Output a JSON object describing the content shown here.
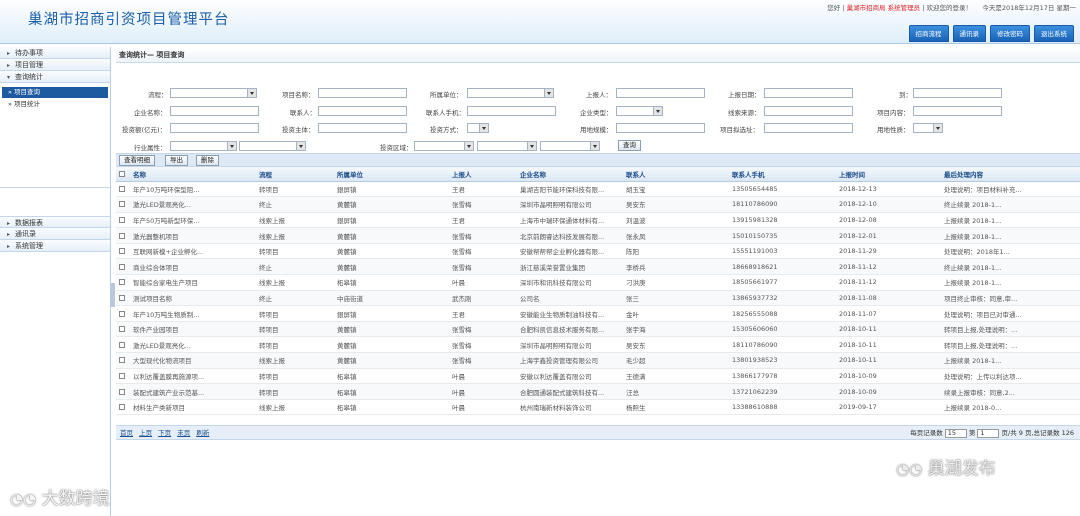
{
  "header": {
    "title": "巢湖市招商引资项目管理平台",
    "greeting_prefix": "您好 |",
    "org": "巢湖市招商局",
    "role": "系统管理员",
    "greeting_suffix": "| 欢迎您的登录！",
    "date": "今天是2018年12月17日 星期一",
    "buttons": [
      "招商流程",
      "通讯录",
      "修改密码",
      "退出系统"
    ]
  },
  "sidebar": {
    "items_top": [
      "待办事项",
      "项目管理",
      "查询统计"
    ],
    "sub_items": [
      "项目查询",
      "项目统计"
    ],
    "items_bottom": [
      "数据报表",
      "通讯录",
      "系统管理"
    ]
  },
  "breadcrumb": "查询统计— 项目查询",
  "form": {
    "labels": {
      "flow": "流程：",
      "project_name": "项目名称：",
      "unit": "所属单位：",
      "reporter": "上报人：",
      "report_date": "上报日期：",
      "to": "到：",
      "company": "企业名称：",
      "contact": "联系人：",
      "contact_phone": "联系人手机：",
      "company_type": "企业类型：",
      "lead_source": "线索来源：",
      "content": "项目内容：",
      "investment": "投资额(亿元)：",
      "invest_body": "投资主体：",
      "invest_method": "投资方式：",
      "land": "用地规模：",
      "site": "项目拟选址：",
      "land_nature": "用地性质：",
      "industry": "行业属性：",
      "region": "投资区域："
    },
    "query_button": "查询"
  },
  "toolbar": [
    "查看明细",
    "导出",
    "删除"
  ],
  "table": {
    "columns": [
      "名称",
      "流程",
      "所属单位",
      "上报人",
      "企业名称",
      "联系人",
      "联系人手机",
      "上报时间",
      "最后处理内容"
    ],
    "rows": [
      [
        "年产10万吨环保型阻...",
        "转项目",
        "銀屏镇",
        "王君",
        "巢湖吉阳节能环保科技有限...",
        "胡玉宝",
        "13505654485",
        "2018-12-13",
        "处理说明：项目材料补充..."
      ],
      [
        "激光LED景观亮化...",
        "终止",
        "黄麓镇",
        "张雪梅",
        "深圳市晶明照明有限公司",
        "吴安东",
        "18110786090",
        "2018-12-10",
        "终止续录 2018-1..."
      ],
      [
        "年产50万吨新型环保...",
        "线索上报",
        "銀屏镇",
        "王君",
        "上海市中瑞环保通体材料有...",
        "刘温波",
        "13915981328",
        "2018-12-08",
        "上报续录 2018-1..."
      ],
      [
        "激光器整机项目",
        "线索上报",
        "黄麓镇",
        "张雪梅",
        "北京前朗睿达科技发展有限...",
        "张永凤",
        "15010150735",
        "2018-12-01",
        "上报续录 2018-1..."
      ],
      [
        "互联网新模+企业孵化...",
        "转项目",
        "黄麓镇",
        "张雪梅",
        "安徽帮帮帮企业孵化器有限...",
        "陈阳",
        "15551191003",
        "2018-11-29",
        "处理说明：2018年1..."
      ],
      [
        "商业综合体项目",
        "终止",
        "黄麓镇",
        "张雪梅",
        "浙江慈溪荣誉置业集团",
        "李桥兵",
        "18668918621",
        "2018-11-12",
        "终止续录 2018-1..."
      ],
      [
        "智能综合家电生产项目",
        "线索上报",
        "柘皋镇",
        "叶晨",
        "深圳市和讯科技有限公司",
        "刁洪庚",
        "18505661977",
        "2018-11-12",
        "上报续录 2018-1..."
      ],
      [
        "测试项目名称",
        "终止",
        "中庙街道",
        "武杰刚",
        "公司名",
        "张三",
        "13865937732",
        "2018-11-08",
        "项目终止审核：同意,审..."
      ],
      [
        "年产10万吨生物质制...",
        "转项目",
        "銀屏镇",
        "王君",
        "安徽能业生物质制油科技有...",
        "金叶",
        "18256555088",
        "2018-11-07",
        "处理说明：项目已对审通..."
      ],
      [
        "软件产业园项目",
        "转项目",
        "黄麓镇",
        "张雪梅",
        "合肥科凯信息技术服务有限...",
        "张宇海",
        "15305606060",
        "2018-10-11",
        "转项目上报,处理说明：..."
      ],
      [
        "激光LED景观亮化...",
        "转项目",
        "黄麓镇",
        "张雪梅",
        "深圳市晶明照明有限公司",
        "吴安东",
        "18110786090",
        "2018-10-11",
        "转项目上报,处理说明：..."
      ],
      [
        "大型现代化物流项目",
        "线索上报",
        "黄麓镇",
        "张雪梅",
        "上海宇鑫投资管理有限公司",
        "毛少超",
        "13801938523",
        "2018-10-11",
        "上报续录 2018-1..."
      ],
      [
        "以利达覆盖膜再施源项...",
        "转项目",
        "柘皋镇",
        "叶晨",
        "安徽以利达覆盖有限公司",
        "王德满",
        "13866177978",
        "2018-10-09",
        "处理说明：上传以利达项..."
      ],
      [
        "装配式建筑产业示范基...",
        "转项目",
        "柘皋镇",
        "叶晨",
        "合肥圆通装配式建筑科技有...",
        "汪总",
        "13721062239",
        "2018-10-09",
        "续录上报审核：同意,2..."
      ],
      [
        "材料生产类新项目",
        "线索上报",
        "柘皋镇",
        "叶晨",
        "杭州南瑞新材料装饰公司",
        "杨照生",
        "13388610888",
        "2019-09-17",
        "上报续录 2018-0..."
      ]
    ]
  },
  "pager": {
    "links": [
      "首页",
      "上页",
      "下页",
      "末页",
      "刷新"
    ],
    "per_page_label": "每页记录数",
    "per_page": "15",
    "page_label": "第",
    "page": "1",
    "summary": "页/共 9 页,总记录数 126"
  },
  "watermarks": {
    "left": "大数跨境",
    "right": "巢湖发布"
  }
}
